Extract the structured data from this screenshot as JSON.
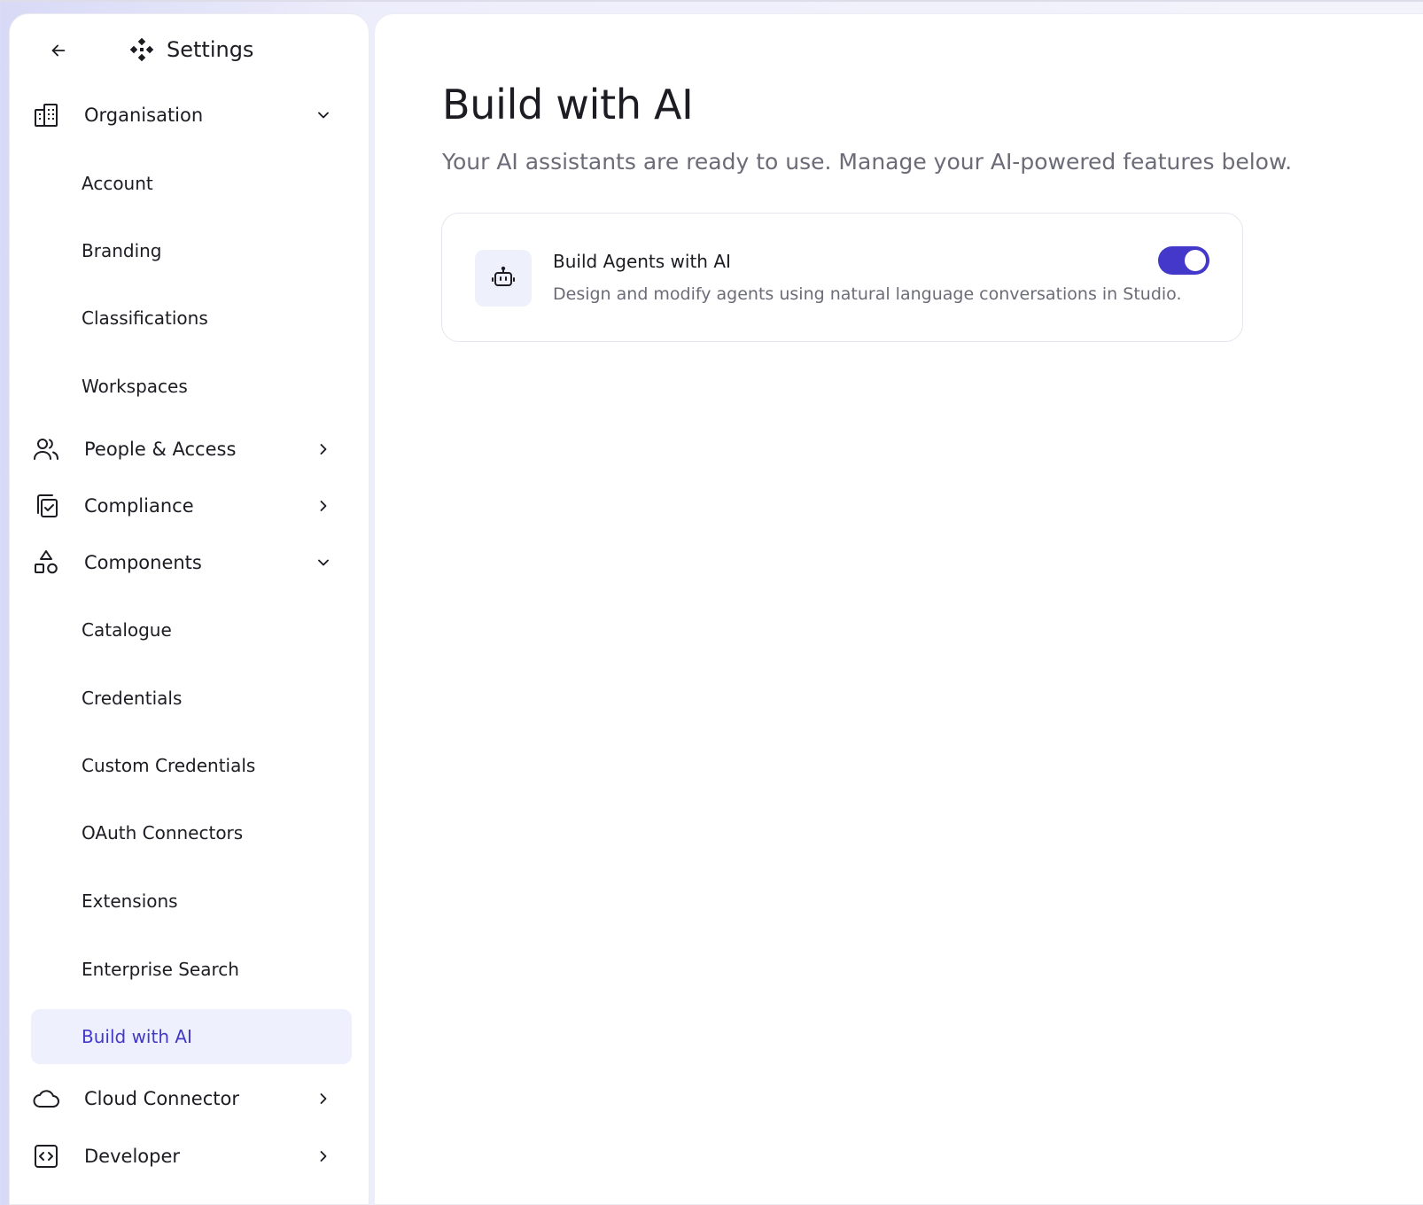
{
  "header": {
    "title": "Settings",
    "back_icon": "arrow-left-icon",
    "logo_icon": "diamond-nodes-icon"
  },
  "sidebar": {
    "sections": [
      {
        "label": "Organisation",
        "icon": "building-icon",
        "expanded": true,
        "items": [
          {
            "label": "Account"
          },
          {
            "label": "Branding"
          },
          {
            "label": "Classifications"
          },
          {
            "label": "Workspaces"
          }
        ]
      },
      {
        "label": "People & Access",
        "icon": "users-icon",
        "expanded": false
      },
      {
        "label": "Compliance",
        "icon": "compliance-check-icon",
        "expanded": false
      },
      {
        "label": "Components",
        "icon": "shapes-icon",
        "expanded": true,
        "items": [
          {
            "label": "Catalogue"
          },
          {
            "label": "Credentials"
          },
          {
            "label": "Custom Credentials"
          },
          {
            "label": "OAuth Connectors"
          },
          {
            "label": "Extensions"
          },
          {
            "label": "Enterprise Search"
          },
          {
            "label": "Build with AI",
            "active": true
          }
        ]
      },
      {
        "label": "Cloud Connector",
        "icon": "cloud-icon",
        "expanded": false
      },
      {
        "label": "Developer",
        "icon": "code-icon",
        "expanded": false
      }
    ]
  },
  "main": {
    "title": "Build with AI",
    "subtitle": "Your AI assistants are ready to use. Manage your AI-powered features below.",
    "features": [
      {
        "title": "Build Agents with AI",
        "description": "Design and modify agents using natural language conversations in Studio.",
        "icon": "robot-icon",
        "enabled": true
      }
    ]
  },
  "colors": {
    "accent": "#4338CA",
    "active_item_bg": "#EEF0FD",
    "active_item_text": "#4339C9",
    "muted_text": "#6C6C78"
  }
}
